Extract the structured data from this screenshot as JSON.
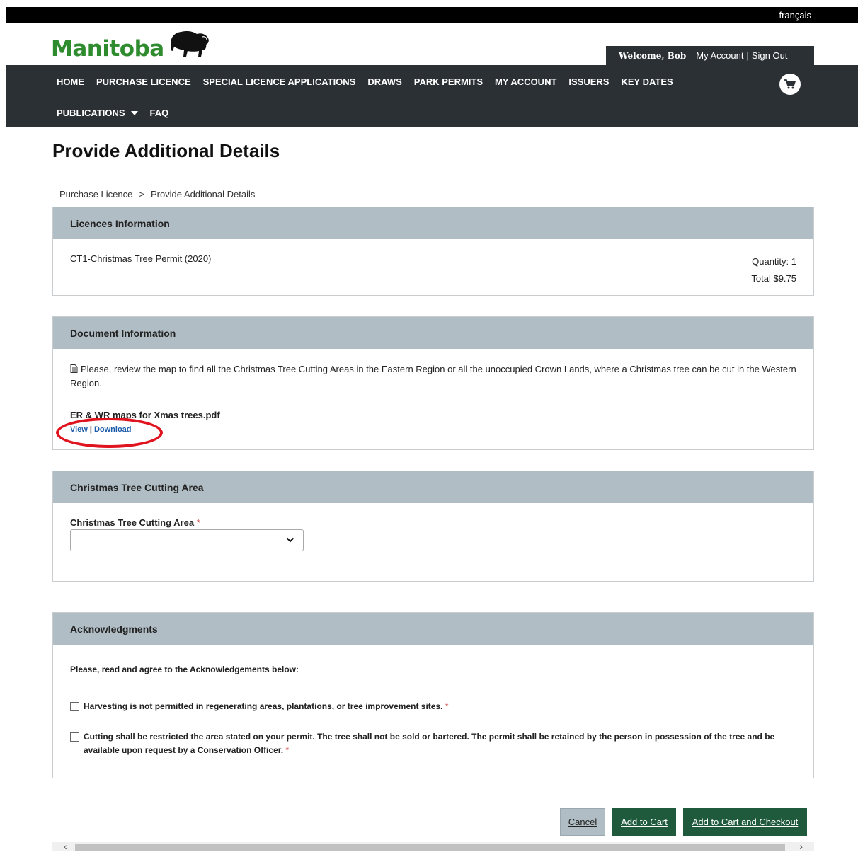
{
  "header": {
    "language_link": "français",
    "logo_text": "Manitoba",
    "welcome": "Welcome, Bob",
    "my_account": "My Account",
    "separator": "|",
    "sign_out": "Sign Out"
  },
  "nav": {
    "row1": [
      "HOME",
      "PURCHASE LICENCE",
      "SPECIAL LICENCE APPLICATIONS",
      "DRAWS",
      "PARK PERMITS",
      "MY ACCOUNT",
      "ISSUERS",
      "KEY DATES"
    ],
    "row2": [
      "PUBLICATIONS",
      "FAQ"
    ],
    "cart_icon": "shopping-cart-icon"
  },
  "page": {
    "title": "Provide Additional Details",
    "breadcrumb": [
      "Purchase Licence",
      ">",
      "Provide Additional Details"
    ]
  },
  "licences": {
    "heading": "Licences Information",
    "item": "CT1-Christmas Tree Permit (2020)",
    "quantity": "Quantity: 1",
    "total": "Total $9.75"
  },
  "document": {
    "heading": "Document Information",
    "description": "Please, review the map to find all the Christmas Tree Cutting Areas in the Eastern Region or all the unoccupied Crown Lands, where a Christmas tree can be cut in the Western Region.",
    "file_name": "ER & WR maps for Xmas trees.pdf",
    "view_label": "View",
    "link_separator": "|",
    "download_label": "Download",
    "highlight_color": "#e0141e"
  },
  "cutting_area": {
    "heading": "Christmas Tree Cutting Area",
    "field_label": "Christmas Tree Cutting Area",
    "required_mark": "*",
    "selected_value": ""
  },
  "acknowledgments": {
    "heading": "Acknowledgments",
    "intro": "Please, read and agree to the Acknowledgements below:",
    "items": [
      "Harvesting is not permitted in regenerating areas, plantations, or tree improvement sites.",
      "Cutting shall be restricted the area stated on your permit. The tree shall not be sold or bartered. The permit shall be retained by the person in possession of the tree and be available upon request by a Conservation Officer."
    ],
    "required_mark": "*"
  },
  "actions": {
    "cancel": "Cancel",
    "add_to_cart": "Add to Cart",
    "add_to_cart_checkout": "Add to Cart and Checkout"
  },
  "colors": {
    "nav_bg": "#2b3035",
    "panel_header_bg": "#b0bdc4",
    "primary_button": "#1f5a3c",
    "logo_green": "#2e8b2e",
    "link_blue": "#1a5aa8"
  }
}
